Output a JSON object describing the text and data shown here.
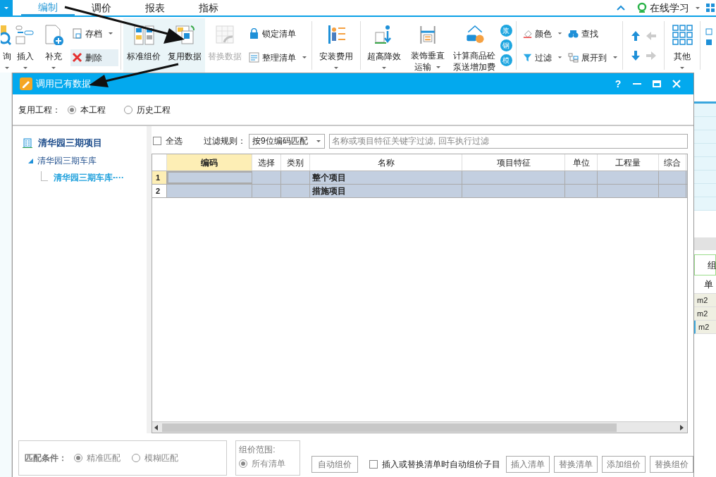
{
  "menu_tabs": [
    {
      "label": "编制",
      "selected": true
    },
    {
      "label": "调价",
      "selected": false
    },
    {
      "label": "报表",
      "selected": false
    },
    {
      "label": "指标",
      "selected": false
    }
  ],
  "online_learning": "在线学习",
  "ribbon": [
    {
      "kind": "large",
      "lines": [
        "询"
      ],
      "dropdown": true
    },
    {
      "kind": "large",
      "lines": [
        "插入"
      ],
      "dropdown": true
    },
    {
      "kind": "large",
      "lines": [
        "补充"
      ],
      "dropdown": true
    },
    {
      "kind": "stack",
      "items": [
        {
          "label": "存档",
          "dropdown": true,
          "highlighted": false
        },
        {
          "label": "删除",
          "dropdown": false,
          "highlighted": true
        }
      ]
    },
    {
      "kind": "separator"
    },
    {
      "kind": "large",
      "lines": [
        "标准组价"
      ],
      "highlighted": true
    },
    {
      "kind": "large",
      "lines": [
        "复用数据"
      ],
      "highlighted": true
    },
    {
      "kind": "large",
      "lines": [
        "替换数据"
      ],
      "disabled": true
    },
    {
      "kind": "stack",
      "items": [
        {
          "label": "锁定清单",
          "dropdown": false,
          "highlighted": false
        },
        {
          "label": "整理清单",
          "dropdown": true,
          "highlighted": false
        }
      ]
    },
    {
      "kind": "separator"
    },
    {
      "kind": "large",
      "lines": [
        "安装费用"
      ],
      "dropdown": true
    },
    {
      "kind": "separator"
    },
    {
      "kind": "large",
      "lines": [
        "超高降效"
      ],
      "dropdown": true
    },
    {
      "kind": "large",
      "lines": [
        "装饰垂直",
        "运输"
      ],
      "dropdown": true
    },
    {
      "kind": "large",
      "lines": [
        "计算商品砼",
        "泵送增加费"
      ],
      "dropdown": false
    },
    {
      "kind": "badges",
      "items": [
        "浆",
        "钢",
        "模"
      ]
    },
    {
      "kind": "separator"
    },
    {
      "kind": "stack",
      "items": [
        {
          "label": "颜色",
          "dropdown": true,
          "highlighted": false
        },
        {
          "label": "过滤",
          "dropdown": true,
          "highlighted": false
        }
      ]
    },
    {
      "kind": "stack",
      "items": [
        {
          "label": "查找",
          "dropdown": false,
          "highlighted": false
        },
        {
          "label": "展开到",
          "dropdown": true,
          "highlighted": false
        }
      ]
    },
    {
      "kind": "separator"
    },
    {
      "kind": "arrows"
    },
    {
      "kind": "separator"
    },
    {
      "kind": "large",
      "lines": [
        "其他"
      ],
      "dropdown": true
    },
    {
      "kind": "separator"
    }
  ],
  "dialog": {
    "title": "调用已有数据",
    "help": "?",
    "reuse_label": "复用工程：",
    "reuse_options": [
      {
        "label": "本工程",
        "selected": true
      },
      {
        "label": "历史工程",
        "selected": false
      }
    ],
    "tree": {
      "label": "清华园三期项目",
      "children": [
        {
          "label": "清华园三期车库",
          "expanded": true,
          "children": [
            {
              "label": "清华园三期车库-···",
              "selected": true
            }
          ]
        }
      ]
    },
    "select_all": {
      "label": "全选",
      "checked": false
    },
    "filter_label": "过滤规则：",
    "filter_value": "按9位编码匹配",
    "search": {
      "placeholder": "名称或项目特征关键字过滤, 回车执行过滤"
    },
    "table": {
      "columns": [
        "编码",
        "选择",
        "类别",
        "名称",
        "项目特征",
        "单位",
        "工程量",
        "综合"
      ],
      "rows": [
        {
          "index": "1",
          "name": "整个项目",
          "selected": true
        },
        {
          "index": "2",
          "name": "措施项目",
          "selected": false
        }
      ]
    },
    "match": {
      "label": "匹配条件：",
      "options": [
        {
          "label": "精准匹配",
          "selected": true
        },
        {
          "label": "模糊匹配",
          "selected": false
        }
      ]
    },
    "scope": {
      "label": "组价范围:",
      "options": [
        {
          "label": "所有清单",
          "selected": true
        }
      ]
    },
    "auto_button": "自动组价",
    "insert_option": {
      "label": "插入或替换清单时自动组价子目",
      "checked": false
    },
    "buttons": [
      "插入清单",
      "替换清单",
      "添加组价",
      "替换组价"
    ]
  },
  "background": {
    "cells": [
      "组",
      "单"
    ],
    "units": [
      "m2",
      "m2",
      "m2"
    ]
  }
}
